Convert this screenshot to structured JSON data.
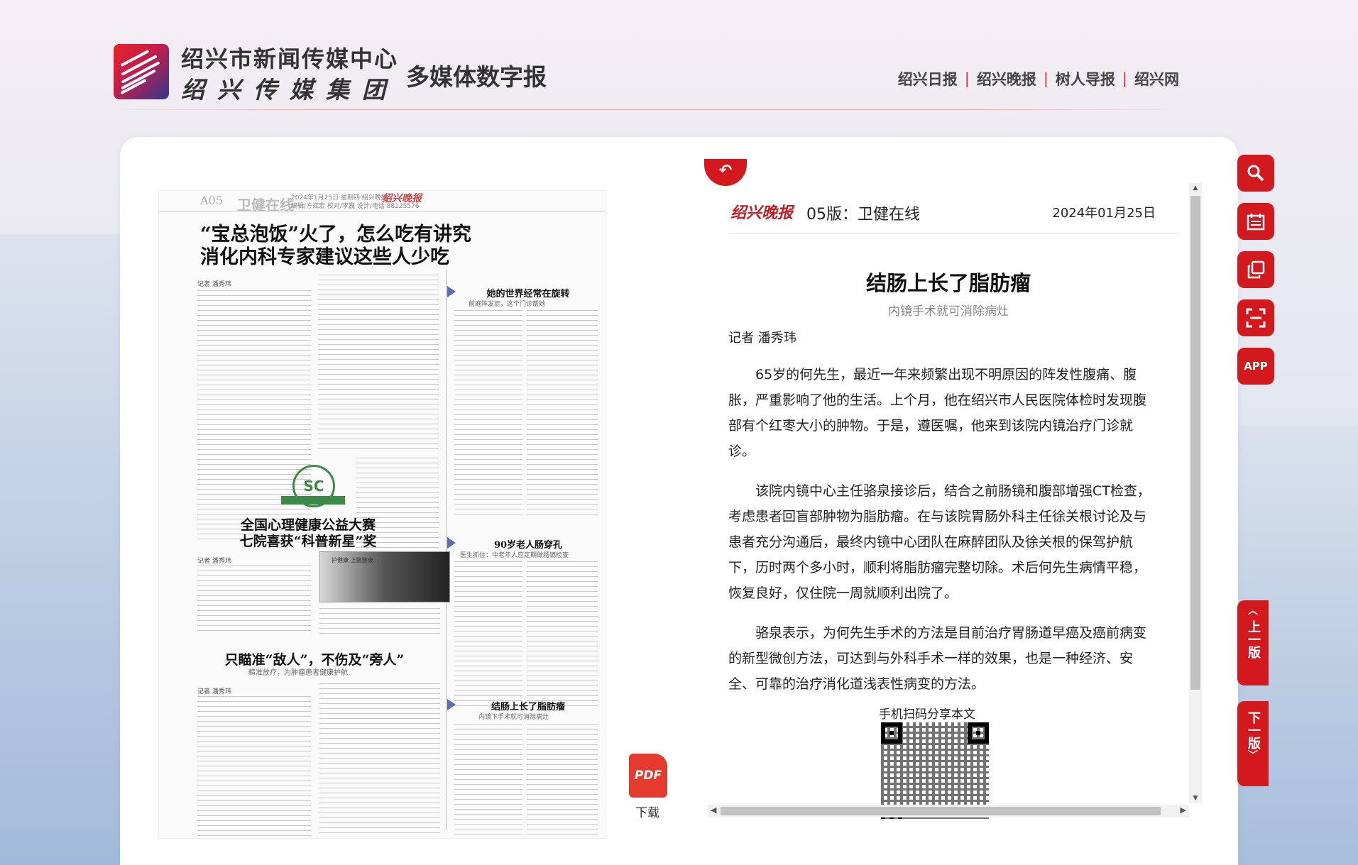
{
  "header": {
    "org_name_line1": "绍兴市新闻传媒中心",
    "org_name_line2": "绍兴传媒集团",
    "subtitle": "多媒体数字报",
    "nav": [
      "绍兴日报",
      "绍兴晚报",
      "树人导报",
      "绍兴网"
    ]
  },
  "paper": {
    "edition": "A05",
    "section": "卫健在线",
    "info": "2024年1月25日  星期四  绍兴晚报",
    "editor_line": "编辑/方斌宏 校对/李巍 设计/电话 88125576",
    "brand": "绍兴晚报",
    "headline": "“宝总泡饭”火了，怎么吃有讲究\n消化内科专家建议这些人少吃",
    "story2_title": "全国心理健康公益大赛\n七院喜获“科普新星”奖",
    "story3_title": "只瞄准“敌人”，不伤及“旁人”",
    "story3_sub": "精准放疗，为肿瘤患者健康护航",
    "right1_title": "她的世界经常在旋转",
    "right1_sub": "前庭阵发症，这个门诊帮她",
    "right2_title": "90岁老人肠穿孔",
    "right2_sub": "医生抓住：中老年人应定期做肠镜检查",
    "right3_title": "结肠上长了脂肪瘤",
    "right3_sub": "内镜下手术就可消除病灶",
    "reporter_tag": "记者 潘秀玮"
  },
  "pdf": {
    "label": "下载",
    "icon_text": "PDF"
  },
  "article": {
    "brand": "绍兴晚报",
    "page": "05版：卫健在线",
    "date": "2024年01月25日",
    "title": "结肠上长了脂肪瘤",
    "subtitle": "内镜手术就可消除病灶",
    "author": "记者 潘秀玮",
    "paragraphs": [
      "65岁的何先生，最近一年来频繁出现不明原因的阵发性腹痛、腹胀，严重影响了他的生活。上个月，他在绍兴市人民医院体检时发现腹部有个红枣大小的肿物。于是，遵医嘱，他来到该院内镜治疗门诊就诊。",
      "该院内镜中心主任骆泉接诊后，结合之前肠镜和腹部增强CT检查，考虑患者回盲部肿物为脂肪瘤。在与该院胃肠外科主任徐关根讨论及与患者充分沟通后，最终内镜中心团队在麻醉团队及徐关根的保驾护航下，历时两个多小时，顺利将脂肪瘤完整切除。术后何先生病情平稳，恢复良好，仅住院一周就顺利出院了。",
      "骆泉表示，为何先生手术的方法是目前治疗胃肠道早癌及癌前病变的新型微创方法，可达到与外科手术一样的效果，也是一种经济、安全、可靠的治疗消化道浅表性病变的方法。"
    ],
    "qr_label": "手机扫码分享本文"
  },
  "tools": {
    "search": "search-icon",
    "calendar": "calendar-icon",
    "copy": "copy-icon",
    "scan": "scan-icon",
    "app_label": "APP"
  },
  "paging": {
    "prev": "上一版",
    "next": "下一版"
  },
  "colors": {
    "accent": "#d4191e",
    "pdf": "#e53a2e"
  }
}
